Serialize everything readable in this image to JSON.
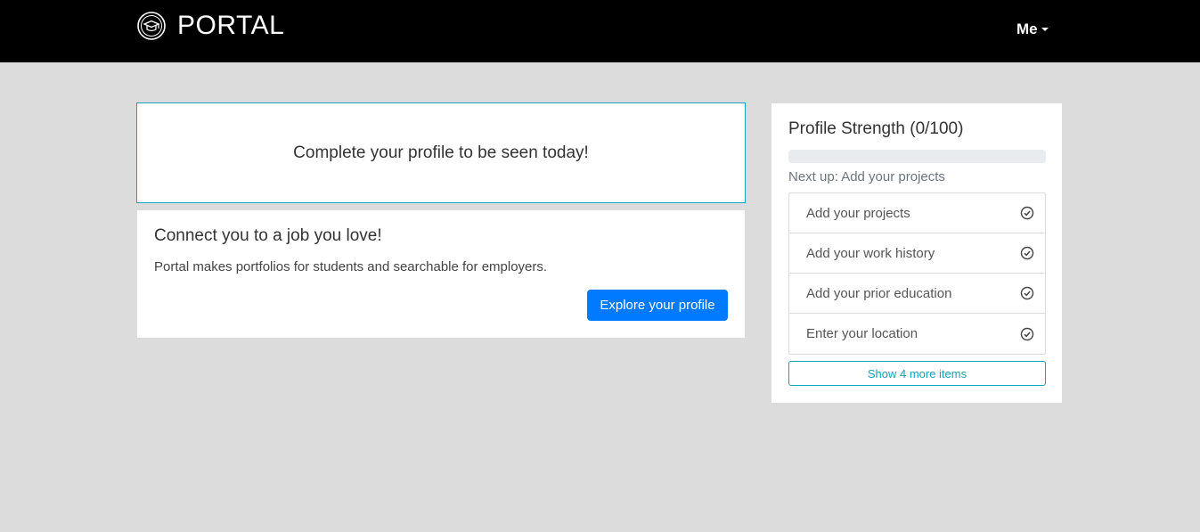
{
  "navbar": {
    "brand_name": "PORTAL",
    "logo_icon": "graduation-seal-icon",
    "user_menu_label": "Me",
    "background": "#000000"
  },
  "callout": {
    "text": "Complete your profile to be seen today!",
    "border_color": "#17a2b8"
  },
  "connect_card": {
    "title": "Connect you to a job you love!",
    "text": "Portal makes portfolios for students and searchable for employers.",
    "button_label": "Explore your profile",
    "button_color": "#007bff"
  },
  "profile_strength": {
    "title": "Profile Strength (0/100)",
    "progress_percent": 0,
    "next_up": "Next up: Add your projects",
    "items": [
      {
        "label": "Add your projects",
        "icon": "check-circle-icon"
      },
      {
        "label": "Add your work history",
        "icon": "check-circle-icon"
      },
      {
        "label": "Add your prior education",
        "icon": "check-circle-icon"
      },
      {
        "label": "Enter your location",
        "icon": "check-circle-icon"
      }
    ],
    "show_more_label": "Show 4 more items"
  }
}
